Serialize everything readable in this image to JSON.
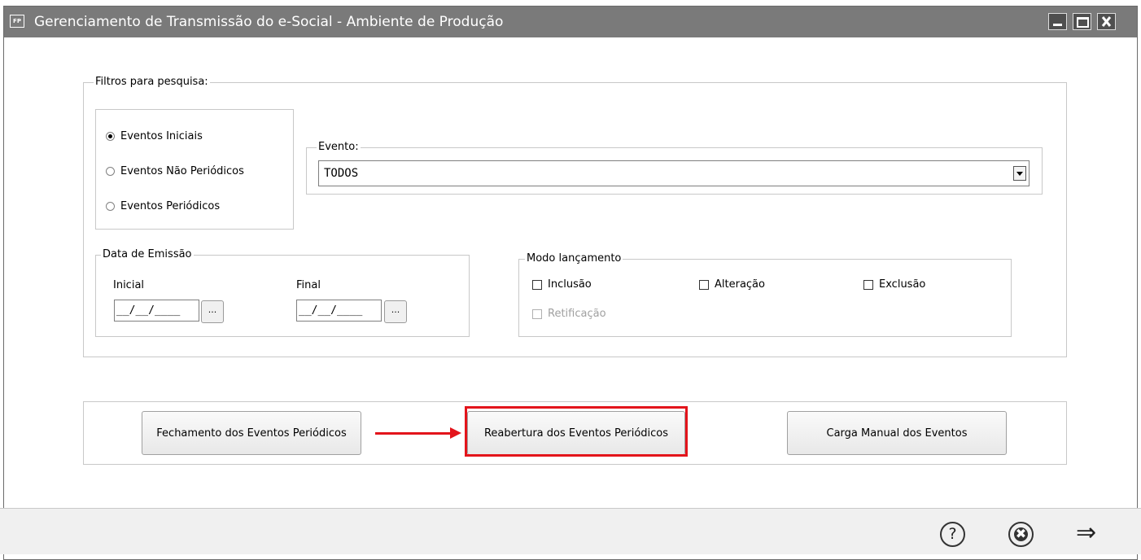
{
  "window": {
    "app_icon": "FP",
    "title": "Gerenciamento de Transmissão do e-Social - Ambiente de Produção"
  },
  "filters": {
    "legend": "Filtros para pesquisa:",
    "event_types": [
      {
        "label": "Eventos Iniciais",
        "selected": true
      },
      {
        "label": "Eventos Não Periódicos",
        "selected": false
      },
      {
        "label": "Eventos Periódicos",
        "selected": false
      }
    ],
    "evento": {
      "legend": "Evento:",
      "value": "TODOS"
    },
    "data_emissao": {
      "legend": "Data de Emissão",
      "inicial_label": "Inicial",
      "inicial_value": "__/__/____",
      "final_label": "Final",
      "final_value": "__/__/____",
      "picker_label": "..."
    },
    "modo_lancamento": {
      "legend": "Modo lançamento",
      "options": [
        {
          "label": "Inclusão",
          "checked": false,
          "enabled": true
        },
        {
          "label": "Alteração",
          "checked": false,
          "enabled": true
        },
        {
          "label": "Exclusão",
          "checked": false,
          "enabled": true
        },
        {
          "label": "Retificação",
          "checked": false,
          "enabled": false
        }
      ]
    }
  },
  "actions": {
    "fechamento": "Fechamento dos Eventos Periódicos",
    "reabertura": "Reabertura dos Eventos Periódicos",
    "carga_manual": "Carga Manual dos Eventos"
  },
  "footer": {
    "help_icon": "?",
    "cancel_icon": "✖",
    "next_icon": "⇒"
  },
  "colors": {
    "titlebar": "#7a7a7a",
    "highlight": "#e3141b"
  }
}
